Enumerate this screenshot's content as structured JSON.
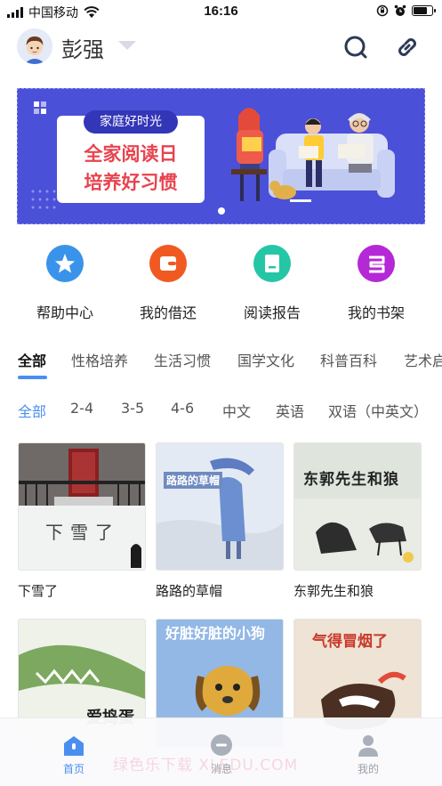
{
  "status_bar": {
    "carrier": "中国移动",
    "time": "16:16"
  },
  "header": {
    "username": "彭强",
    "search_icon": "search-icon",
    "link_icon": "link-icon"
  },
  "banner": {
    "tag": "家庭好时光",
    "line1": "全家阅读日",
    "line2": "培养好习惯",
    "background_color": "#4b50d9"
  },
  "quick_actions": [
    {
      "label": "帮助中心",
      "icon": "star-icon",
      "color": "#3a93ea"
    },
    {
      "label": "我的借还",
      "icon": "wallet-icon",
      "color": "#f05a22"
    },
    {
      "label": "阅读报告",
      "icon": "report-icon",
      "color": "#25c6a6"
    },
    {
      "label": "我的书架",
      "icon": "bookshelf-icon",
      "color": "#b428d6"
    }
  ],
  "categories": [
    "全部",
    "性格培养",
    "生活习惯",
    "国学文化",
    "科普百科",
    "艺术启"
  ],
  "filters": [
    "全部",
    "2-4",
    "3-5",
    "4-6",
    "中文",
    "英语",
    "双语（中英文）"
  ],
  "books": [
    {
      "title": "下雪了",
      "cover_text": "下雪了"
    },
    {
      "title": "路路的草帽",
      "cover_text": "路路的草帽"
    },
    {
      "title": "东郭先生和狼",
      "cover_text": "东郭先生和狼"
    },
    {
      "title": "",
      "cover_text": "爱捣蛋"
    },
    {
      "title": "",
      "cover_text": "好脏好脏的小狗"
    },
    {
      "title": "",
      "cover_text": "气得冒烟了"
    }
  ],
  "bottom_nav": [
    {
      "label": "首页",
      "icon": "home-icon",
      "active": true
    },
    {
      "label": "消息",
      "icon": "message-icon",
      "active": false
    },
    {
      "label": "我的",
      "icon": "profile-icon",
      "active": false
    }
  ],
  "watermark": "绿色乐下载 XLEDU.COM",
  "colors": {
    "accent": "#4a8ff0"
  }
}
